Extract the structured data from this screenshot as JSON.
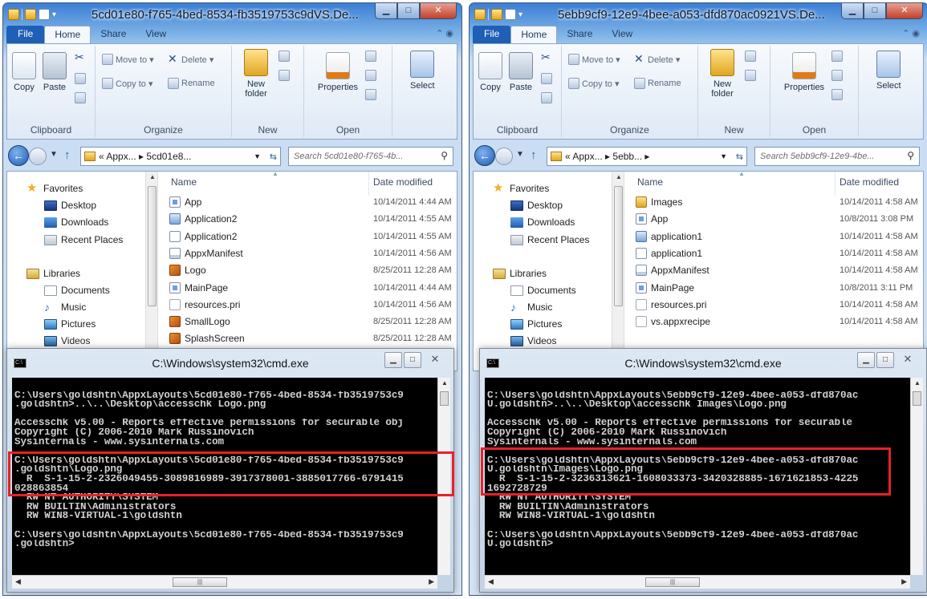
{
  "windows": [
    {
      "title": "5cd01e80-f765-4bed-8534-fb3519753c9dVS.De...",
      "ribbon_tabs": [
        "File",
        "Home",
        "Share",
        "View"
      ],
      "ribbon": {
        "copy": "Copy",
        "paste": "Paste",
        "clipboard": "Clipboard",
        "move_to": "Move to ▾",
        "delete": "Delete ▾",
        "copy_to": "Copy to ▾",
        "rename": "Rename",
        "organize": "Organize",
        "new_folder": "New folder",
        "new": "New",
        "properties": "Properties",
        "open": "Open",
        "select": "Select"
      },
      "address": "« Appx... ▸ 5cd01e8...",
      "search_placeholder": "Search 5cd01e80-f765-4b...",
      "nav": {
        "favorites": "Favorites",
        "desktop": "Desktop",
        "downloads": "Downloads",
        "recent": "Recent Places",
        "libraries": "Libraries",
        "documents": "Documents",
        "music": "Music",
        "pictures": "Pictures",
        "videos": "Videos"
      },
      "columns": {
        "name": "Name",
        "date": "Date modified"
      },
      "files": [
        {
          "name": "App",
          "date": "10/14/2011 4:44 AM",
          "icon": "app"
        },
        {
          "name": "Application2",
          "date": "10/14/2011 4:55 AM",
          "icon": "xaml"
        },
        {
          "name": "Application2",
          "date": "10/14/2011 4:55 AM",
          "icon": "doc"
        },
        {
          "name": "AppxManifest",
          "date": "10/14/2011 4:56 AM",
          "icon": "manifest"
        },
        {
          "name": "Logo",
          "date": "8/25/2011 12:28 AM",
          "icon": "img"
        },
        {
          "name": "MainPage",
          "date": "10/14/2011 4:44 AM",
          "icon": "app"
        },
        {
          "name": "resources.pri",
          "date": "10/14/2011 4:56 AM",
          "icon": "txt"
        },
        {
          "name": "SmallLogo",
          "date": "8/25/2011 12:28 AM",
          "icon": "img"
        },
        {
          "name": "SplashScreen",
          "date": "8/25/2011 12:28 AM",
          "icon": "img"
        }
      ]
    },
    {
      "title": "5ebb9cf9-12e9-4bee-a053-dfd870ac0921VS.De...",
      "ribbon_tabs": [
        "File",
        "Home",
        "Share",
        "View"
      ],
      "ribbon": {
        "copy": "Copy",
        "paste": "Paste",
        "clipboard": "Clipboard",
        "move_to": "Move to ▾",
        "delete": "Delete ▾",
        "copy_to": "Copy to ▾",
        "rename": "Rename",
        "organize": "Organize",
        "new_folder": "New folder",
        "new": "New",
        "properties": "Properties",
        "open": "Open",
        "select": "Select"
      },
      "address": "« Appx... ▸ 5ebb... ▸",
      "search_placeholder": "Search 5ebb9cf9-12e9-4be...",
      "nav": {
        "favorites": "Favorites",
        "desktop": "Desktop",
        "downloads": "Downloads",
        "recent": "Recent Places",
        "libraries": "Libraries",
        "documents": "Documents",
        "music": "Music",
        "pictures": "Pictures",
        "videos": "Videos"
      },
      "columns": {
        "name": "Name",
        "date": "Date modified"
      },
      "files": [
        {
          "name": "Images",
          "date": "10/14/2011 4:58 AM",
          "icon": "folder"
        },
        {
          "name": "App",
          "date": "10/8/2011 3:08 PM",
          "icon": "app"
        },
        {
          "name": "application1",
          "date": "10/14/2011 4:58 AM",
          "icon": "xaml"
        },
        {
          "name": "application1",
          "date": "10/14/2011 4:58 AM",
          "icon": "doc"
        },
        {
          "name": "AppxManifest",
          "date": "10/14/2011 4:58 AM",
          "icon": "manifest"
        },
        {
          "name": "MainPage",
          "date": "10/8/2011 3:11 PM",
          "icon": "app"
        },
        {
          "name": "resources.pri",
          "date": "10/14/2011 4:58 AM",
          "icon": "txt"
        },
        {
          "name": "vs.appxrecipe",
          "date": "10/14/2011 4:58 AM",
          "icon": "txt"
        }
      ]
    }
  ],
  "cmds": [
    {
      "title": "C:\\Windows\\system32\\cmd.exe",
      "lines": [
        "",
        "C:\\Users\\goldshtn\\AppxLayouts\\5cd01e80-f765-4bed-8534-fb3519753c9",
        ".goldshtn>..\\..\\Desktop\\accesschk Logo.png",
        "",
        "Accesschk v5.00 - Reports effective permissions for securable obj",
        "Copyright (C) 2006-2010 Mark Russinovich",
        "Sysinternals - www.sysinternals.com",
        "",
        "C:\\Users\\goldshtn\\AppxLayouts\\5cd01e80-f765-4bed-8534-fb3519753c9",
        ".goldshtn\\Logo.png",
        "  R  S-1-15-2-2326049455-3089816989-3917378001-3885017766-6791415",
        "028863854",
        "  RW NT AUTHORITY\\SYSTEM",
        "  RW BUILTIN\\Administrators",
        "  RW WIN8-VIRTUAL-1\\goldshtn",
        "",
        "C:\\Users\\goldshtn\\AppxLayouts\\5cd01e80-f765-4bed-8534-fb3519753c9",
        ".goldshtn>"
      ]
    },
    {
      "title": "C:\\Windows\\system32\\cmd.exe",
      "lines": [
        "",
        "C:\\Users\\goldshtn\\AppxLayouts\\5ebb9cf9-12e9-4bee-a053-dfd870ac",
        "U.goldshtn>..\\..\\Desktop\\accesschk Images\\Logo.png",
        "",
        "Accesschk v5.00 - Reports effective permissions for securable",
        "Copyright (C) 2006-2010 Mark Russinovich",
        "Sysinternals - www.sysinternals.com",
        "",
        "C:\\Users\\goldshtn\\AppxLayouts\\5ebb9cf9-12e9-4bee-a053-dfd870ac",
        "U.goldshtn\\Images\\Logo.png",
        "  R  S-1-15-2-3236313621-1608033373-3420328885-1671621853-4225",
        "1692728729",
        "  RW NT AUTHORITY\\SYSTEM",
        "  RW BUILTIN\\Administrators",
        "  RW WIN8-VIRTUAL-1\\goldshtn",
        "",
        "C:\\Users\\goldshtn\\AppxLayouts\\5ebb9cf9-12e9-4bee-a053-dfd870ac",
        "U.goldshtn>"
      ]
    }
  ],
  "colors": {
    "highlight_box": "#e8202a",
    "console_bg": "#000000",
    "console_fg": "#d0d0d0"
  }
}
